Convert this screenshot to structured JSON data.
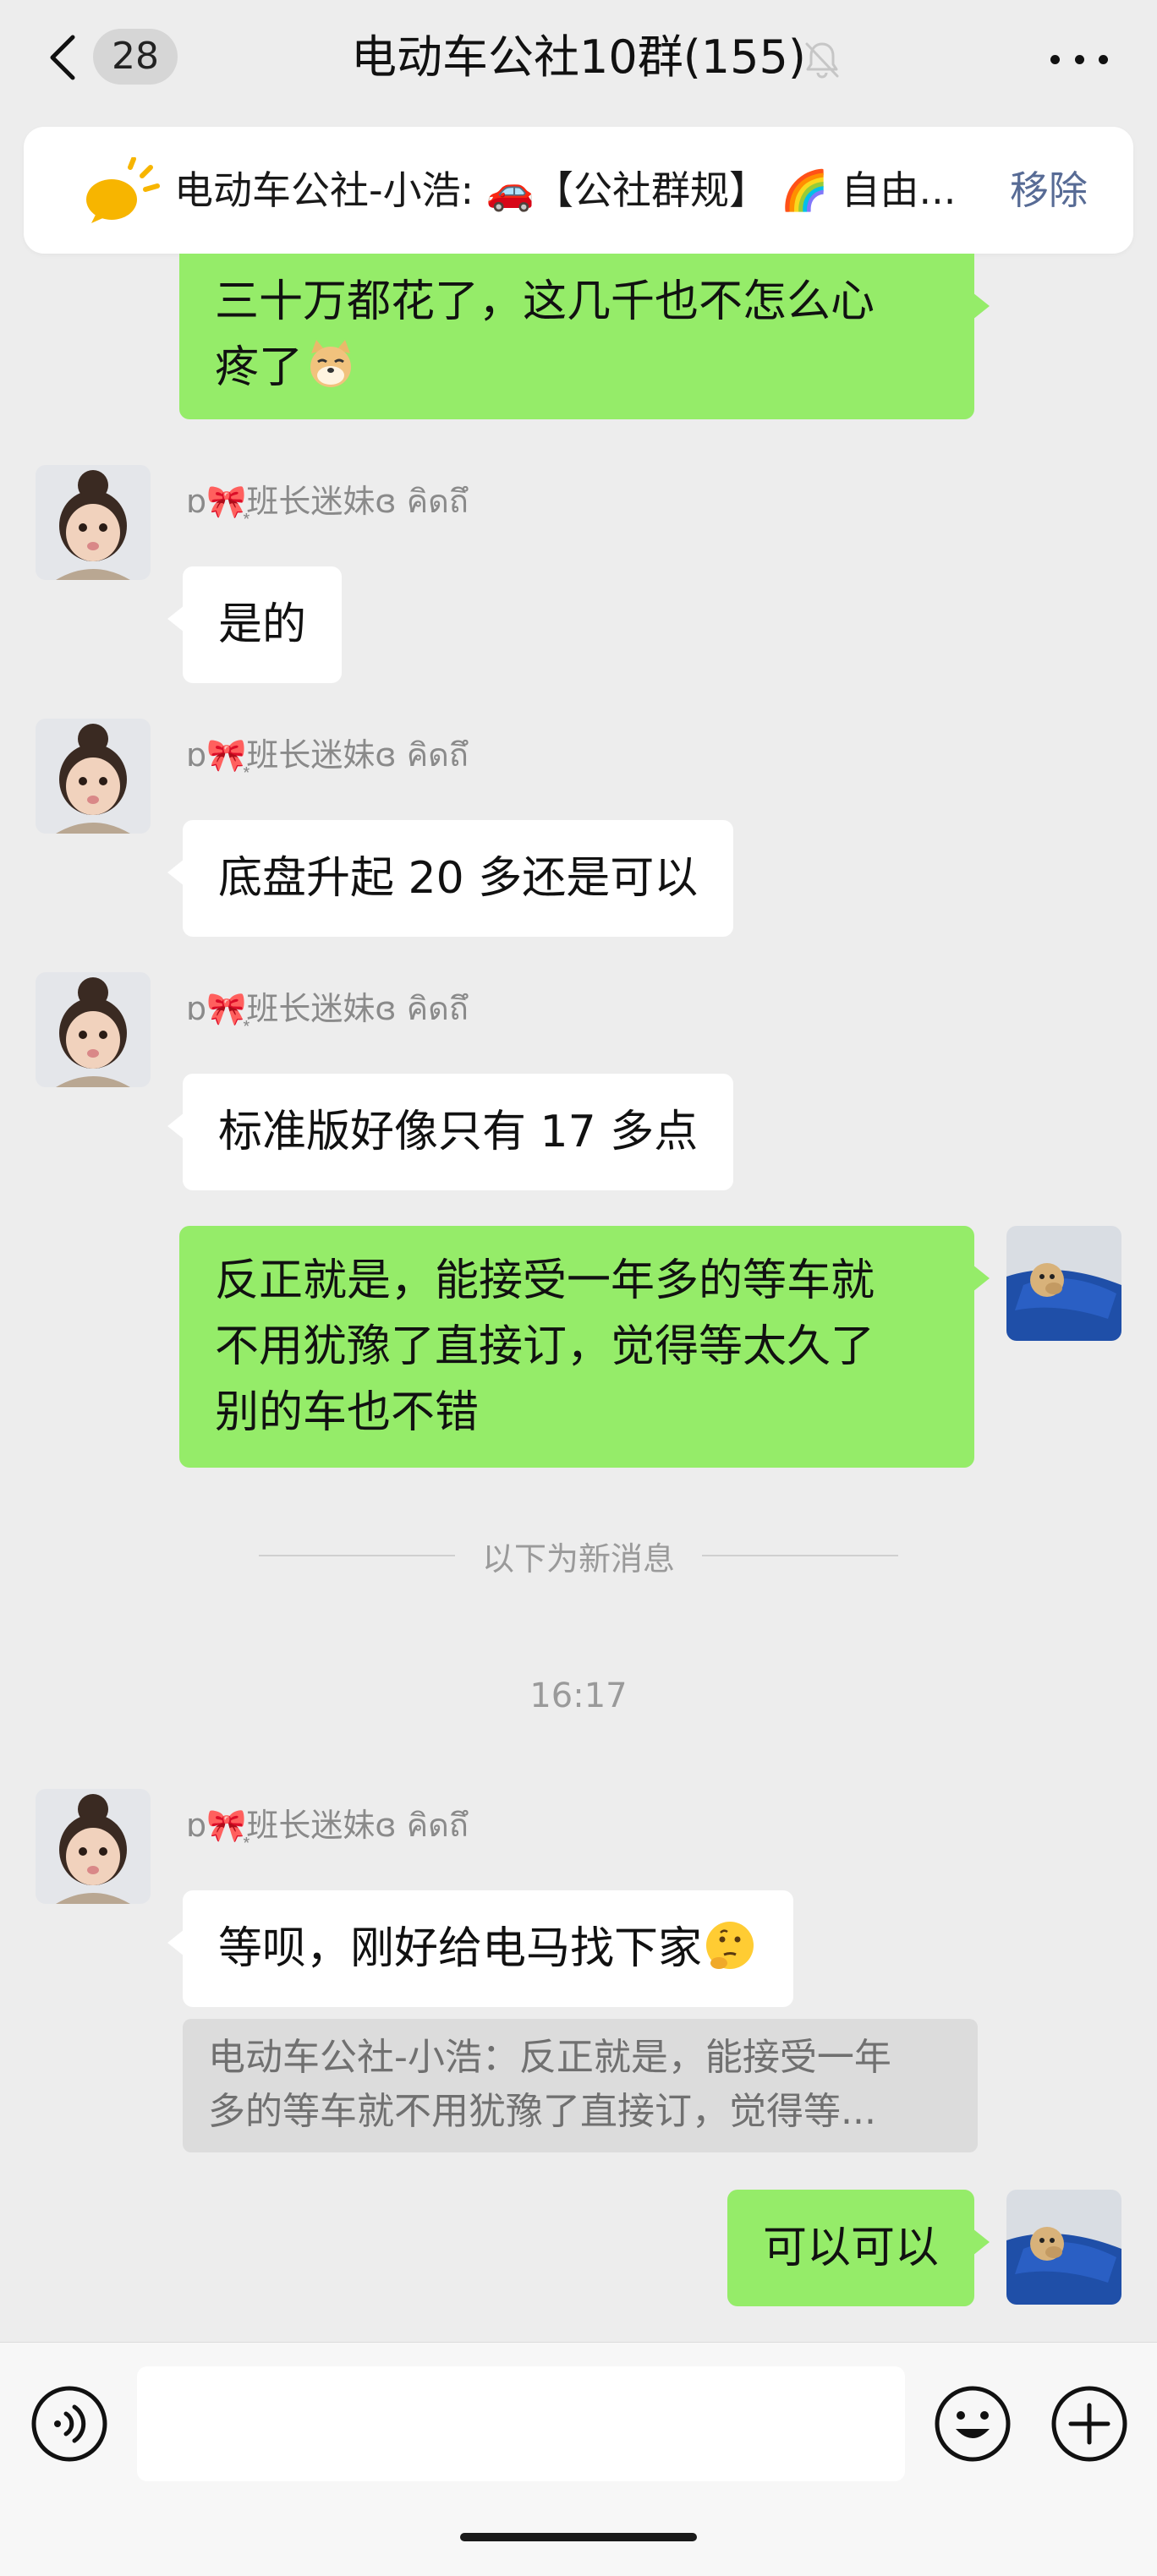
{
  "header": {
    "unread_count": "28",
    "title": "电动车公社10群(155)",
    "back_icon": "chevron-left-icon",
    "mute_icon": "bell-off-icon",
    "more_icon": "more-dots-icon"
  },
  "notice": {
    "icon": "megaphone-icon",
    "text": "电动车公社-小浩: 🚗【公社群规】 🌈 自由...",
    "action": "移除"
  },
  "messages": [
    {
      "side": "right",
      "lines": [
        "三十万都花了，这几千也不怎么心",
        "疼了"
      ],
      "emoji": "doge-emoji"
    },
    {
      "side": "left",
      "sender": "ɒ🎀͙班长迷妹ɞ คิดถึ",
      "text": "是的"
    },
    {
      "side": "left",
      "sender": "ɒ🎀͙班长迷妹ɞ คิดถึ",
      "text": "底盘升起 20 多还是可以"
    },
    {
      "side": "left",
      "sender": "ɒ🎀͙班长迷妹ɞ คิดถึ",
      "text": "标准版好像只有 17 多点"
    },
    {
      "side": "right",
      "lines": [
        "反正就是，能接受一年多的等车就",
        "不用犹豫了直接订，觉得等太久了",
        "别的车也不错"
      ]
    },
    {
      "side": "left",
      "sender": "ɒ🎀͙班长迷妹ɞ คิดถึ",
      "text": "等呗，刚好给电马找下家",
      "emoji": "thinking-emoji",
      "quote": [
        "电动车公社-小浩：反正就是，能接受一年",
        "多的等车就不用犹豫了直接订，觉得等..."
      ]
    },
    {
      "side": "right",
      "text": "可以可以"
    }
  ],
  "divider_text": "以下为新消息",
  "timestamp": "16:17",
  "input": {
    "voice_icon": "voice-icon",
    "emoji_icon": "emoji-face-icon",
    "plus_icon": "plus-circle-icon",
    "value": ""
  },
  "colors": {
    "background": "#ededed",
    "bubble_self": "#95ec69",
    "bubble_other": "#ffffff",
    "link": "#576b95"
  }
}
